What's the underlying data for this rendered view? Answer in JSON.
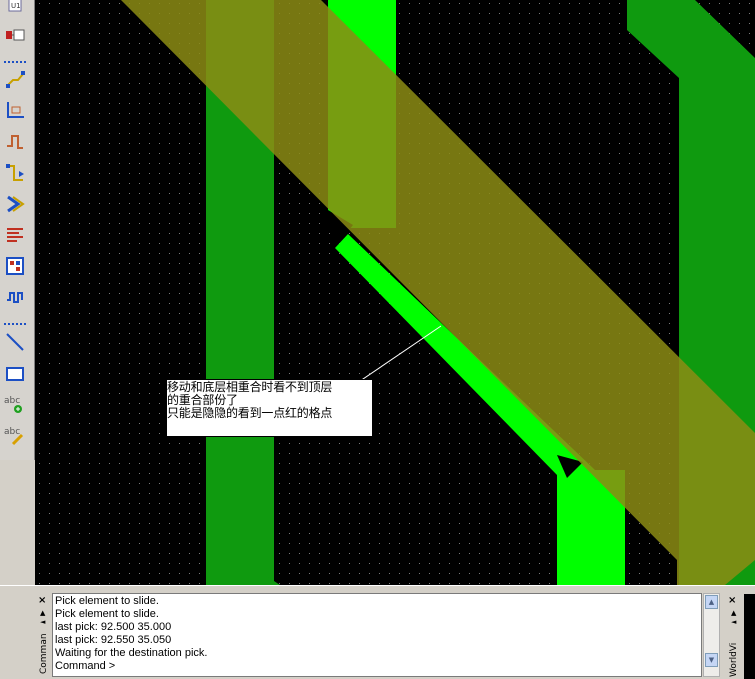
{
  "toolbar": {
    "tools": [
      {
        "icon": "chip-icon"
      },
      {
        "icon": "component-icon"
      },
      {
        "icon": "route-track-icon"
      },
      {
        "icon": "dimension-icon"
      },
      {
        "icon": "trace-shape-icon"
      },
      {
        "icon": "connect-icon"
      },
      {
        "icon": "drc-icon"
      },
      {
        "icon": "layers-icon"
      },
      {
        "icon": "grid-icon"
      },
      {
        "icon": "tune-icon"
      },
      {
        "icon": "line-icon"
      },
      {
        "icon": "rectangle-icon"
      },
      {
        "icon": "add-text-icon"
      },
      {
        "icon": "edit-text-icon"
      }
    ],
    "text_icon_label": "abc"
  },
  "canvas": {
    "colors": {
      "background": "#000000",
      "bottom_layer": "#0f9a0f",
      "top_layer": "#00ff00",
      "moving_track": "#8c8c14",
      "grid_dot": "#7a7a7a",
      "leader": "#ffffff"
    },
    "annotation": {
      "lines": [
        "移动和底层相重合时看不到顶层",
        "的重合部份了",
        "只能是隐隐的看到一点红的格点"
      ]
    }
  },
  "command_window": {
    "title": "Comman",
    "close_glyph": "×",
    "lines": [
      "Pick element to slide.",
      "Pick element to slide.",
      "last pick:  92.500  35.000",
      "last pick:  92.550  35.050",
      "Waiting for the destination pick.",
      "Command >"
    ]
  },
  "worldview": {
    "title": "WorldVi",
    "close_glyph": "×"
  }
}
